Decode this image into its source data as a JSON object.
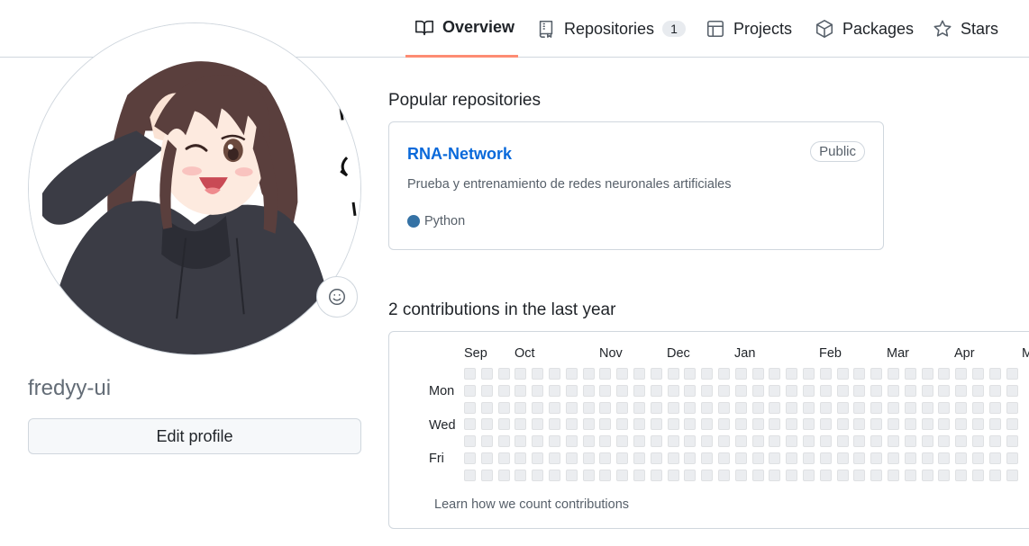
{
  "nav": {
    "tabs": [
      {
        "label": "Overview",
        "icon": "book-icon",
        "selected": true
      },
      {
        "label": "Repositories",
        "icon": "repo-icon",
        "count": "1"
      },
      {
        "label": "Projects",
        "icon": "table-icon"
      },
      {
        "label": "Packages",
        "icon": "package-icon"
      },
      {
        "label": "Stars",
        "icon": "star-icon"
      }
    ],
    "accent": "#fd8c73"
  },
  "profile": {
    "username": "fredyy-ui",
    "edit_label": "Edit profile",
    "status_icon": "smiley-icon",
    "avatar": "anime-girl-avatar"
  },
  "popular": {
    "title": "Popular repositories",
    "repos": [
      {
        "name": "RNA-Network",
        "visibility": "Public",
        "description": "Prueba y entrenamiento de redes neuronales artificiales",
        "language": "Python",
        "language_color": "#3572A5"
      }
    ]
  },
  "contributions": {
    "title": "2 contributions in the last year",
    "months": [
      "Sep",
      "Oct",
      "Nov",
      "Dec",
      "Jan",
      "Feb",
      "Mar",
      "Apr",
      "M"
    ],
    "day_labels": [
      "Mon",
      "Wed",
      "Fri"
    ],
    "learn_link": "Learn how we count contributions",
    "empty_color": "#ebedf0"
  }
}
